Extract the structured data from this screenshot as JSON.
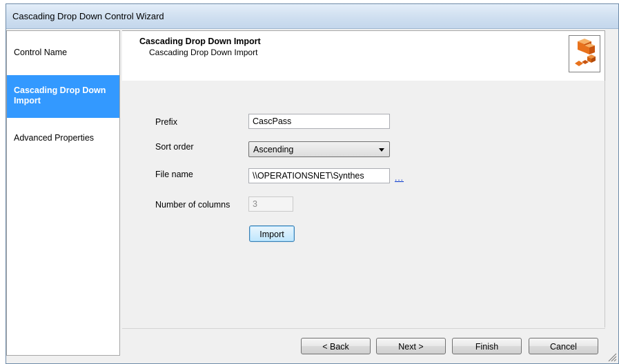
{
  "window": {
    "title": "Cascading Drop Down Control Wizard"
  },
  "sidebar": {
    "items": [
      {
        "label": "Control Name",
        "active": false
      },
      {
        "label": "Cascading Drop Down Import",
        "active": true
      },
      {
        "label": "Advanced Properties",
        "active": false
      }
    ]
  },
  "header": {
    "title": "Cascading Drop Down Import",
    "subtitle": "Cascading Drop Down Import",
    "icon": "cubes-icon"
  },
  "form": {
    "prefix": {
      "label": "Prefix",
      "value": "CascPass"
    },
    "sort_order": {
      "label": "Sort order",
      "value": "Ascending"
    },
    "file_name": {
      "label": "File name",
      "value": "\\\\OPERATIONSNET\\Synthes",
      "browse_label": "..."
    },
    "num_columns": {
      "label": "Number of columns",
      "value": "3"
    },
    "import_label": "Import"
  },
  "footer": {
    "back_label": "< Back",
    "next_label": "Next >",
    "finish_label": "Finish",
    "cancel_label": "Cancel"
  },
  "colors": {
    "accent": "#3399ff",
    "link": "#0033cc"
  }
}
